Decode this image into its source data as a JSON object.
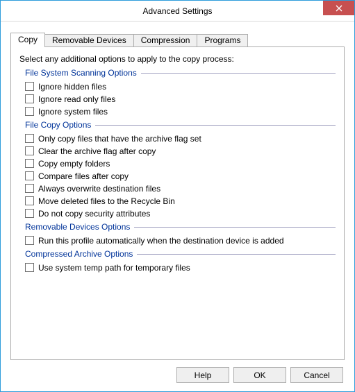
{
  "title": "Advanced Settings",
  "tabs": [
    "Copy",
    "Removable Devices",
    "Compression",
    "Programs"
  ],
  "active_tab": 0,
  "intro": "Select any additional options to apply to the copy process:",
  "groups": [
    {
      "title": "File System Scanning Options",
      "items": [
        "Ignore hidden files",
        "Ignore read only files",
        "Ignore system files"
      ]
    },
    {
      "title": "File Copy Options",
      "items": [
        "Only copy files that have the archive flag set",
        "Clear the archive flag after copy",
        "Copy empty folders",
        "Compare files after copy",
        "Always overwrite destination files",
        "Move deleted files to the Recycle Bin",
        "Do not copy security attributes"
      ]
    },
    {
      "title": "Removable Devices Options",
      "items": [
        "Run this profile automatically when the destination device is added"
      ]
    },
    {
      "title": "Compressed Archive Options",
      "items": [
        "Use system temp path for temporary files"
      ]
    }
  ],
  "buttons": {
    "help": "Help",
    "ok": "OK",
    "cancel": "Cancel"
  }
}
